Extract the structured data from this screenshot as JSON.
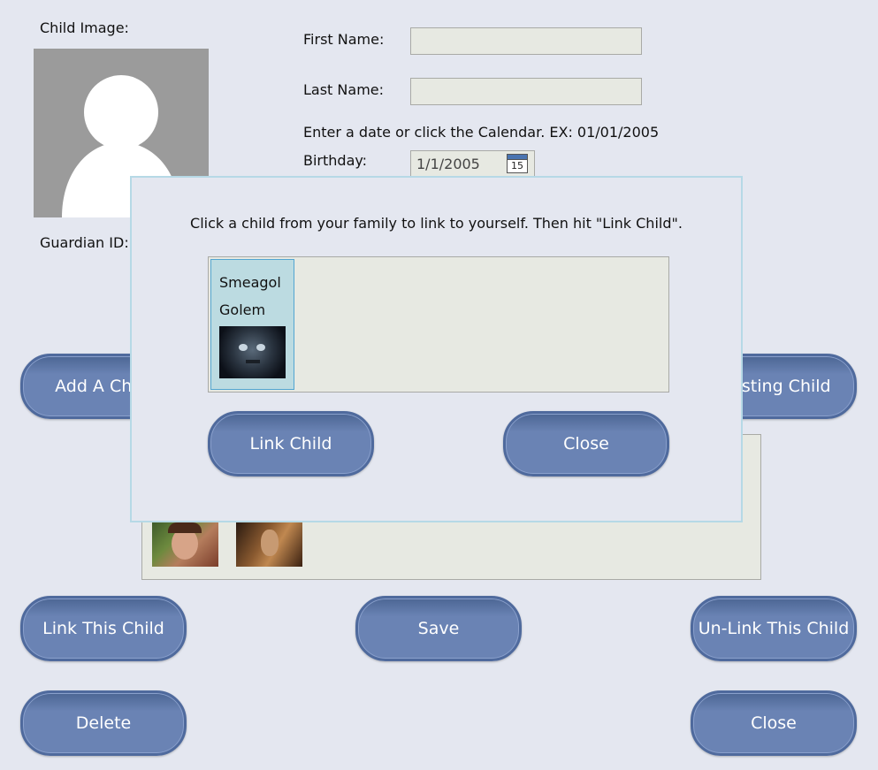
{
  "form": {
    "child_image_label": "Child Image:",
    "guardian_id_label": "Guardian ID:",
    "first_name_label": "First Name:",
    "first_name_value": "",
    "last_name_label": "Last Name:",
    "last_name_value": "",
    "date_hint": "Enter a date or click the Calendar. EX: 01/01/2005",
    "birthday_label": "Birthday:",
    "birthday_value": "1/1/2005",
    "calendar_day": "15"
  },
  "buttons": {
    "add_child": "Add A Child",
    "existing_child": "Existing Child",
    "link_this_child": "Link This Child",
    "save": "Save",
    "unlink_this_child": "Un-Link This Child",
    "delete": "Delete",
    "close": "Close"
  },
  "dialog": {
    "instruction": "Click a child from your family to link to yourself. Then hit \"Link Child\".",
    "children": [
      {
        "first_name": "Smeagol",
        "last_name": "Golem",
        "selected": true
      }
    ],
    "link_child_label": "Link Child",
    "close_label": "Close"
  },
  "icons": {
    "avatar": "person-silhouette-icon",
    "calendar": "calendar-icon"
  },
  "colors": {
    "background": "#e4e7f0",
    "button_fill": "#6a83b4",
    "button_border": "#4f6a9d",
    "selection": "#bcdbe1",
    "dialog_border": "#b6d9e6"
  }
}
